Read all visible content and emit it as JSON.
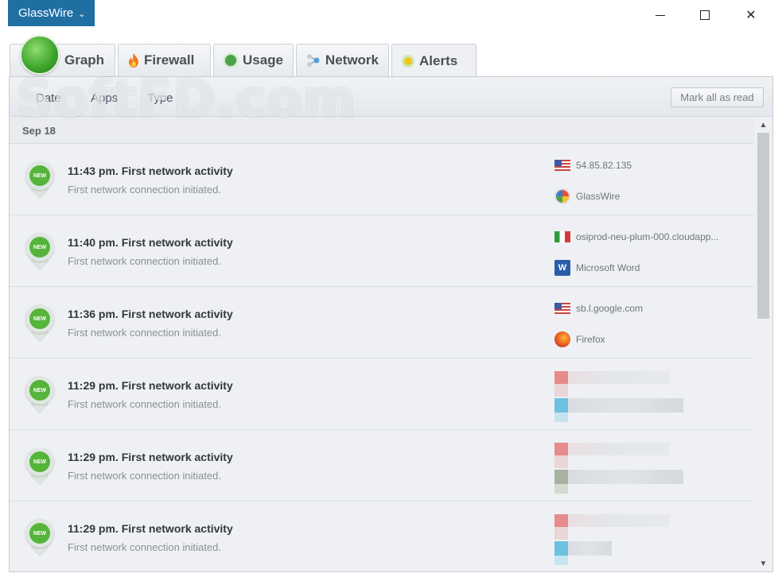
{
  "app": {
    "brand_label": "GlassWire",
    "brand_color": "#1f6fa3",
    "accent_green": "#55b43a"
  },
  "window_controls": {
    "minimize": "minimize-icon",
    "maximize": "maximize-icon",
    "close": "close-icon"
  },
  "tabs": [
    {
      "label": "Graph",
      "icon": "graph-logo-icon"
    },
    {
      "label": "Firewall",
      "icon": "flame-icon"
    },
    {
      "label": "Usage",
      "icon": "usage-icon"
    },
    {
      "label": "Network",
      "icon": "network-icon"
    },
    {
      "label": "Alerts",
      "icon": "alert-icon",
      "active": true
    }
  ],
  "filters": {
    "date": "Date",
    "apps": "Apps",
    "type": "Type",
    "mark_all_read": "Mark all as read"
  },
  "watermark": "SoftFD.com",
  "list": {
    "date_header": "Sep 18",
    "badge": "NEW",
    "alerts": [
      {
        "title": "11:43 pm. First network activity",
        "subtitle": "First network connection initiated.",
        "host": "54.85.82.135",
        "app": "GlassWire"
      },
      {
        "title": "11:40 pm. First network activity",
        "subtitle": "First network connection initiated.",
        "host": "osiprod-neu-plum-000.cloudapp...",
        "app": "Microsoft Word"
      },
      {
        "title": "11:36 pm. First network activity",
        "subtitle": "First network connection initiated.",
        "host": "sb.l.google.com",
        "app": "Firefox"
      },
      {
        "title": "11:29 pm. First network activity",
        "subtitle": "First network connection initiated."
      },
      {
        "title": "11:29 pm. First network activity",
        "subtitle": "First network connection initiated."
      },
      {
        "title": "11:29 pm. First network activity",
        "subtitle": "First network connection initiated."
      }
    ]
  }
}
